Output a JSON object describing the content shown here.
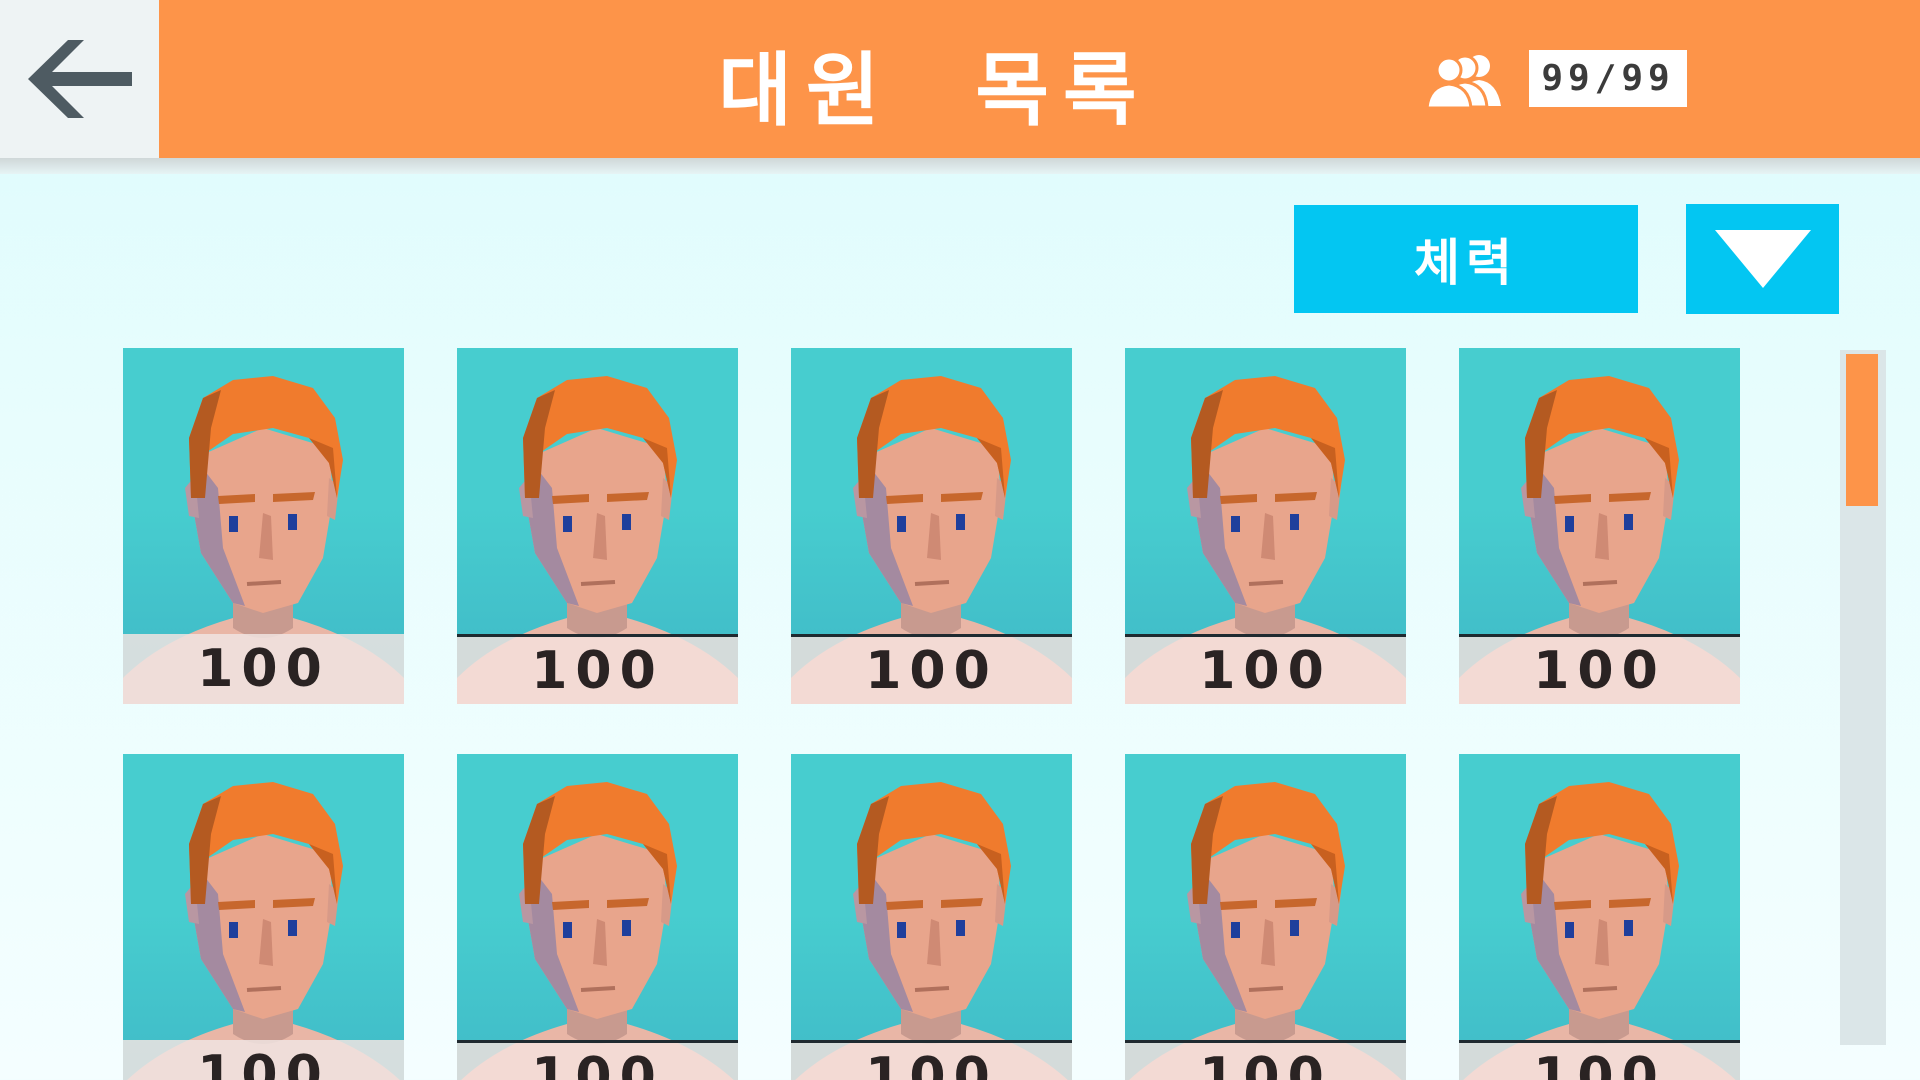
{
  "header": {
    "title": "대원 목록",
    "member_count": "99/99",
    "back_icon": "arrow-left-icon",
    "members_icon": "group-icon",
    "accent_color": "#fd9449"
  },
  "sort": {
    "label": "체력",
    "dropdown_icon": "triangle-down-icon",
    "button_color": "#03c6f2"
  },
  "crew": [
    {
      "stat": "100"
    },
    {
      "stat": "100"
    },
    {
      "stat": "100"
    },
    {
      "stat": "100"
    },
    {
      "stat": "100"
    },
    {
      "stat": "100"
    },
    {
      "stat": "100"
    },
    {
      "stat": "100"
    },
    {
      "stat": "100"
    },
    {
      "stat": "100"
    }
  ],
  "scrollbar": {
    "position_fraction": 0.0
  }
}
